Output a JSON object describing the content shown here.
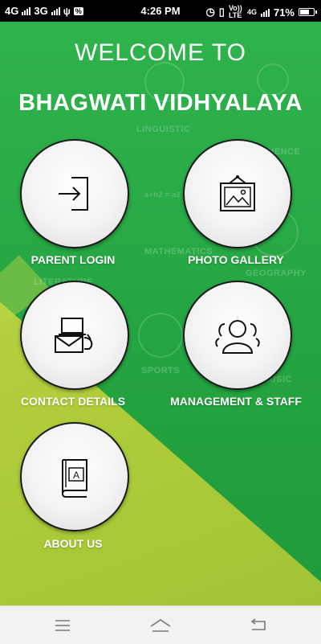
{
  "status_bar": {
    "left_net1": "4G",
    "left_net2": "3G",
    "left_badge": "%",
    "time": "4:26 PM",
    "volte": "Vo)) LTE",
    "right_net": "4G",
    "battery": "71%",
    "battery_level": 0.71
  },
  "header": {
    "welcome": "WELCOME TO",
    "school_name": "BHAGWATI VIDHYALAYA"
  },
  "background_words": [
    "LINGUISTIC",
    "SCIENCE",
    "MATHEMATICS",
    "GEOGRAPHY",
    "LITERATURE",
    "SPORTS",
    "MUSIC",
    "a+b2 = a2"
  ],
  "menu": {
    "parent_login": "PARENT LOGIN",
    "photo_gallery": "PHOTO GALLERY",
    "contact_details": "CONTACT DETAILS",
    "management_staff": "MANAGEMENT & STAFF",
    "about_us": "ABOUT US"
  },
  "icons": {
    "parent_login": "login-arrow-icon",
    "photo_gallery": "picture-frame-icon",
    "contact_details": "mail-laptop-icon",
    "management_staff": "people-group-icon",
    "about_us": "book-icon"
  },
  "navigation": [
    "menu-icon",
    "home-icon",
    "back-icon"
  ],
  "colors": {
    "primary_green": "#2fb34c",
    "accent_yellow": "#c6d94a",
    "circle_border": "#1a1a1a"
  }
}
